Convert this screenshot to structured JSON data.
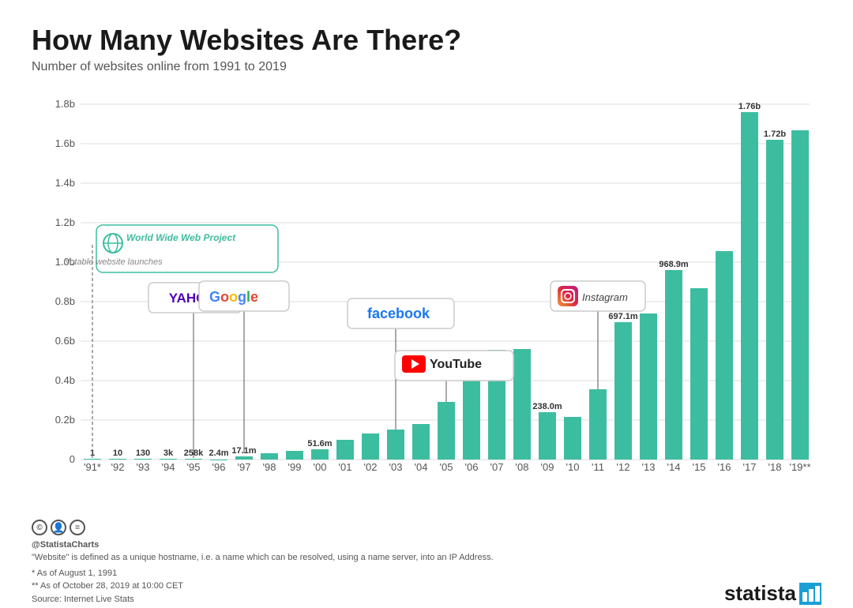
{
  "title": "How Many Websites Are There?",
  "subtitle": "Number of websites online from 1991 to 2019",
  "chart": {
    "bar_color": "#3dbda0",
    "bar_color_highlight": "#2a9d85",
    "years": [
      "'91*",
      "'92",
      "'93",
      "'94",
      "'95",
      "'96",
      "'97",
      "'98",
      "'99",
      "'00",
      "'01",
      "'02",
      "'03",
      "'04",
      "'05",
      "'06",
      "'07",
      "'08",
      "'09",
      "'10",
      "'11",
      "'12",
      "'13",
      "'14",
      "'15",
      "'16",
      "'17",
      "'18",
      "'19**"
    ],
    "values": [
      1,
      10,
      130,
      3000,
      258000,
      2400000,
      17100000,
      30000000,
      40000000,
      51600000,
      110000000,
      150000000,
      170000000,
      200000000,
      290000000,
      430000000,
      560000000,
      630000000,
      238000000,
      206000000,
      350000000,
      697100000,
      740000000,
      968900000,
      870000000,
      1060000000,
      1760000000,
      1620000000,
      1720000000
    ],
    "max_value": 1800000000,
    "labels": {
      "1": "1",
      "10": "10",
      "130": "130",
      "3000": "3k",
      "258000": "258k",
      "2400000": "2.4m",
      "17100000": "17.1m",
      "51600000": "51.6m",
      "238000000": "238.0m",
      "697100000": "697.1m",
      "968900000": "968.9m",
      "1760000000": "1.76b",
      "1620000000": "1.72b"
    },
    "y_axis": [
      "0",
      "0.2b",
      "0.4b",
      "0.6b",
      "0.8b",
      "1.0b",
      "1.2b",
      "1.4b",
      "1.6b",
      "1.8b"
    ],
    "annotations": [
      {
        "id": "wwwproject",
        "label": "World Wide Web Project",
        "sublabel": "Notable website launches",
        "year_index": 0,
        "type": "globe"
      },
      {
        "id": "yahoo",
        "label": "YAHOO!",
        "year_index": 4,
        "type": "logo"
      },
      {
        "id": "google",
        "label": "Google",
        "year_index": 6,
        "type": "logo"
      },
      {
        "id": "facebook",
        "label": "facebook",
        "year_index": 12,
        "type": "logo"
      },
      {
        "id": "youtube",
        "label": "YouTube",
        "year_index": 14,
        "type": "logo"
      },
      {
        "id": "instagram",
        "label": "Instagram",
        "year_index": 20,
        "type": "logo"
      }
    ]
  },
  "footer": {
    "definition": "\"Website\" is defined as a unique hostname, i.e. a name which can be resolved, using a name server, into an IP Address.",
    "note1": "*  As of August 1, 1991",
    "note2": "** As of October 28, 2019 at 10:00 CET",
    "source": "Source: Internet Live Stats",
    "brand": "@StatistaCharts",
    "statista_label": "statista"
  }
}
